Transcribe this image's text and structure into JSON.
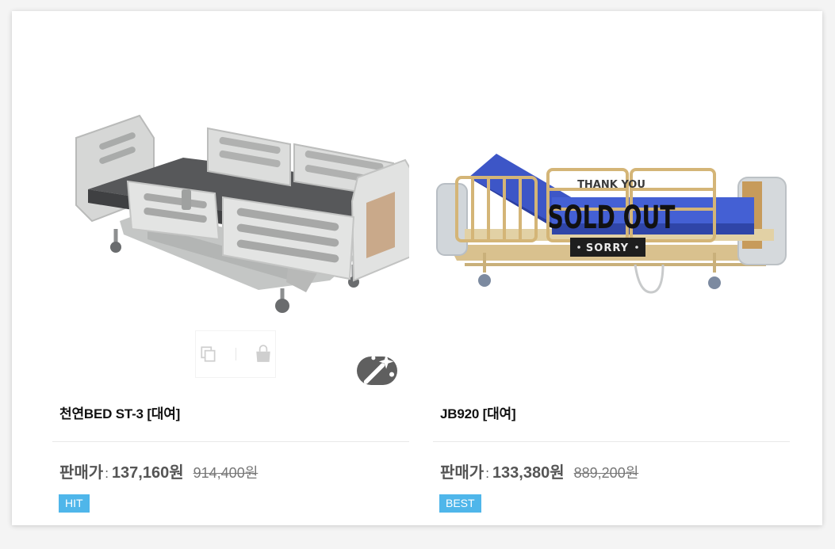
{
  "products": [
    {
      "name": "천연BED ST-3 [대여]",
      "price_label": "판매가",
      "price_colon": ":",
      "price": "137,160원",
      "original_price": "914,400원",
      "badge": "HIT",
      "image": "electric-hospital-bed-gray",
      "icons": [
        "copy-icon",
        "shopping-bag-icon",
        "magic-wand-icon"
      ]
    },
    {
      "name": "JB920 [대여]",
      "price_label": "판매가",
      "price_colon": ":",
      "price": "133,380원",
      "original_price": "889,200원",
      "badge": "BEST",
      "image": "hospital-bed-blue-mattress",
      "sold_out": {
        "top": "THANK YOU",
        "main": "SOLD OUT",
        "bottom": "SORRY"
      }
    }
  ],
  "colors": {
    "badge": "#4fb6ea",
    "price_text": "#555555",
    "title_text": "#111111"
  }
}
